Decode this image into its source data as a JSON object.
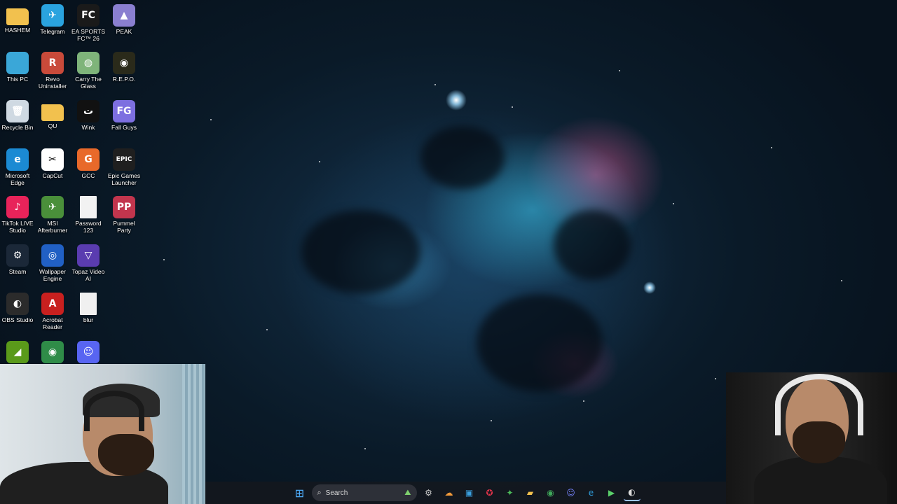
{
  "desktop": {
    "icons": [
      {
        "label": "HASHEM",
        "icon": "folder-icon",
        "color": "#f2c14e",
        "glyph": ""
      },
      {
        "label": "Telegram",
        "icon": "telegram-icon",
        "color": "#2aa3df",
        "glyph": "✈"
      },
      {
        "label": "EA SPORTS FC™ 26",
        "icon": "ea-sports-fc-icon",
        "color": "#1a1a1a",
        "glyph": "FC"
      },
      {
        "label": "PEAK",
        "icon": "peak-game-icon",
        "color": "#8a7fd0",
        "glyph": "▲"
      },
      {
        "label": "This PC",
        "icon": "monitor-icon",
        "color": "#3aa7d8",
        "glyph": ""
      },
      {
        "label": "Revo Uninstaller",
        "icon": "revo-uninstaller-icon",
        "color": "#c94a3a",
        "glyph": "R"
      },
      {
        "label": "Carry The Glass",
        "icon": "carry-the-glass-icon",
        "color": "#7fb47a",
        "glyph": "◍"
      },
      {
        "label": "R.E.P.O.",
        "icon": "repo-game-icon",
        "color": "#2a2a1a",
        "glyph": "◉"
      },
      {
        "label": "Recycle Bin",
        "icon": "recycle-bin-icon",
        "color": "#cfd9e2",
        "glyph": "🗑"
      },
      {
        "label": "QU",
        "icon": "folder-icon",
        "color": "#f2c14e",
        "glyph": ""
      },
      {
        "label": "Wink",
        "icon": "wink-icon",
        "color": "#111111",
        "glyph": "ت"
      },
      {
        "label": "Fall Guys",
        "icon": "fall-guys-icon",
        "color": "#7d6fe0",
        "glyph": "FG"
      },
      {
        "label": "Microsoft Edge",
        "icon": "edge-icon",
        "color": "#1b8ad3",
        "glyph": "e"
      },
      {
        "label": "CapCut",
        "icon": "capcut-icon",
        "color": "#ffffff",
        "glyph": "✂"
      },
      {
        "label": "GCC",
        "icon": "gcc-icon",
        "color": "#e8692a",
        "glyph": "G"
      },
      {
        "label": "Epic Games Launcher",
        "icon": "epic-games-icon",
        "color": "#1f1f1f",
        "glyph": "EPIC"
      },
      {
        "label": "TikTok LIVE Studio",
        "icon": "tiktok-icon",
        "color": "#e8235a",
        "glyph": "♪"
      },
      {
        "label": "MSI Afterburner",
        "icon": "msi-afterburner-icon",
        "color": "#4a8f3a",
        "glyph": "✈"
      },
      {
        "label": "Password 123",
        "icon": "text-file-icon",
        "color": "#f2f2f2",
        "glyph": ""
      },
      {
        "label": "Pummel Party",
        "icon": "pummel-party-icon",
        "color": "#c2354d",
        "glyph": "PP"
      },
      {
        "label": "Steam",
        "icon": "steam-icon",
        "color": "#1b2838",
        "glyph": "⚙"
      },
      {
        "label": "Wallpaper Engine",
        "icon": "wallpaper-engine-icon",
        "color": "#2160c4",
        "glyph": "◎"
      },
      {
        "label": "Topaz Video AI",
        "icon": "topaz-video-ai-icon",
        "color": "#5a3cb0",
        "glyph": "▽"
      },
      {
        "label": "",
        "icon": "empty-slot",
        "color": "transparent",
        "glyph": ""
      },
      {
        "label": "OBS Studio",
        "icon": "obs-studio-icon",
        "color": "#2b2b2b",
        "glyph": "◐"
      },
      {
        "label": "Acrobat Reader",
        "icon": "acrobat-reader-icon",
        "color": "#c8201f",
        "glyph": "A"
      },
      {
        "label": "blur",
        "icon": "blank-file-icon",
        "color": "#f0f0f0",
        "glyph": ""
      },
      {
        "label": "",
        "icon": "empty-slot",
        "color": "transparent",
        "glyph": ""
      },
      {
        "label": "",
        "icon": "nvidia-icon",
        "color": "#5a9a1a",
        "glyph": "◢"
      },
      {
        "label": "",
        "icon": "chrome-icon",
        "color": "#2f8c48",
        "glyph": "◉"
      },
      {
        "label": "",
        "icon": "discord-icon",
        "color": "#5865f2",
        "glyph": "☺"
      }
    ]
  },
  "taskbar": {
    "search_label": "Search",
    "items": [
      {
        "name": "start-button",
        "icon": "windows-icon",
        "glyph": "⊞",
        "color": "#4fb0ff"
      },
      {
        "name": "settings-button",
        "icon": "gear-icon",
        "glyph": "⚙",
        "color": "#c8c8c8"
      },
      {
        "name": "cloud-app-button",
        "icon": "cloud-icon",
        "glyph": "☁",
        "color": "#f29a3a"
      },
      {
        "name": "photos-button",
        "icon": "photos-icon",
        "glyph": "▣",
        "color": "#3aa0e0"
      },
      {
        "name": "app-red-button",
        "icon": "red-app-icon",
        "glyph": "✪",
        "color": "#e0344a"
      },
      {
        "name": "app-green-button",
        "icon": "green-app-icon",
        "glyph": "✦",
        "color": "#4dbb5a"
      },
      {
        "name": "file-explorer-button",
        "icon": "folder-icon",
        "glyph": "▰",
        "color": "#f2c14e"
      },
      {
        "name": "chrome-button",
        "icon": "chrome-icon",
        "glyph": "◉",
        "color": "#3fa85a"
      },
      {
        "name": "discord-button",
        "icon": "discord-icon",
        "glyph": "☺",
        "color": "#7885ff"
      },
      {
        "name": "edge-button",
        "icon": "edge-icon",
        "glyph": "e",
        "color": "#2fa0e0"
      },
      {
        "name": "media-player-button",
        "icon": "play-icon",
        "glyph": "▶",
        "color": "#5ad06a"
      },
      {
        "name": "obs-button",
        "icon": "obs-studio-icon",
        "glyph": "◐",
        "color": "#dddddd"
      }
    ]
  }
}
